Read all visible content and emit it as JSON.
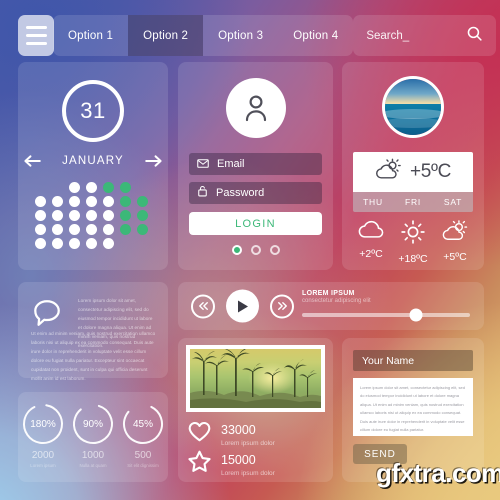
{
  "header": {
    "menu_icon": "hamburger-icon",
    "tabs": [
      {
        "label": "Option 1",
        "active": false
      },
      {
        "label": "Option 2",
        "active": true
      },
      {
        "label": "Option 3",
        "active": false
      },
      {
        "label": "Option 4",
        "active": false
      }
    ],
    "search": {
      "value": "Search_",
      "icon": "search-icon"
    }
  },
  "calendar": {
    "day": "31",
    "month": "JANUARY",
    "prev_icon": "arrow-left-icon",
    "next_icon": "arrow-right-icon",
    "accent": "#3cb878",
    "grid": [
      [
        "o",
        "o",
        "w",
        "w",
        "g",
        "g",
        "o"
      ],
      [
        "w",
        "w",
        "w",
        "w",
        "w",
        "g",
        "g"
      ],
      [
        "w",
        "w",
        "w",
        "w",
        "w",
        "g",
        "g"
      ],
      [
        "w",
        "w",
        "w",
        "w",
        "w",
        "g",
        "g"
      ],
      [
        "w",
        "w",
        "w",
        "w",
        "w",
        "o",
        "o"
      ]
    ]
  },
  "login": {
    "avatar_icon": "user-icon",
    "email": {
      "label": "Email",
      "icon": "envelope-icon"
    },
    "password": {
      "label": "Password",
      "icon": "lock-icon"
    },
    "submit_label": "LOGIN",
    "submit_color": "#3cb878",
    "pager": [
      "on",
      "off",
      "off"
    ]
  },
  "weather": {
    "globe_icon": "ocean-photo",
    "current": {
      "icon": "sun-cloud-icon",
      "temp": "+5ºC"
    },
    "days": [
      "THU",
      "FRI",
      "SAT"
    ],
    "forecast": [
      {
        "icon": "cloud-icon",
        "temp": "+2ºC"
      },
      {
        "icon": "sun-icon",
        "temp": "+18ºC"
      },
      {
        "icon": "sun-cloud-icon",
        "temp": "+5ºC"
      }
    ]
  },
  "quote": {
    "icon": "speech-bubble-icon",
    "text_top": "Lorem ipsum dolor sit amet, consectetur adipiscing elit, sed do eiusmod tempor incididunt ut labore et dolore magna aliqua. Ut enim ad minim veniam, quis nostrud exercitation.",
    "text_bottom": "Ut enim ad minim veniam, quis nostrud exercitation ullamco laboris nisi ut aliquip ex ea commodo consequat. Duis aute irure dolor in reprehenderit in voluptate velit esse cillum dolore eu fugiat nulla pariatur. Excepteur sint occaecat cupidatat non proident, sunt in culpa qui officia deserunt mollit anim id est laborum."
  },
  "media": {
    "prev_icon": "rewind-icon",
    "play_icon": "play-icon",
    "next_icon": "fast-forward-icon",
    "title": "LOREM IPSUM",
    "subtitle": "consectetur adipiscing elit",
    "progress": 68
  },
  "stats": {
    "items": [
      {
        "percent": "180%",
        "value": 180,
        "number": "2000",
        "caption": "Lorem ipsum"
      },
      {
        "percent": "90%",
        "value": 90,
        "number": "1000",
        "caption": "Nulla at quam"
      },
      {
        "percent": "45%",
        "value": 45,
        "number": "500",
        "caption": "Sit elit dignissim"
      }
    ]
  },
  "photo": {
    "image": "palm-tree-sunset-photo",
    "social": [
      {
        "icon": "heart-icon",
        "count": "33000",
        "caption": "Lorem ipsum dolor"
      },
      {
        "icon": "star-icon",
        "count": "15000",
        "caption": "Lorem ipsum dolor"
      }
    ]
  },
  "contact": {
    "name_field": {
      "value": "Your Name"
    },
    "message": "Lorem ipsum dolor sit amet, consectetur adipiscing elit, sed do eiusmod tempor incididunt ut labore et dolore magna aliqua. Ut enim ad minim veniam, quis nostrud exercitation ullamco laboris nisi ut aliquip ex ea commodo consequat. Duis aute irure dolor in reprehenderit in voluptate velit esse cillum dolore eu fugiat nulla pariatur.",
    "send_label": "SEND"
  },
  "watermark": {
    "text": "gfxtra.com"
  }
}
